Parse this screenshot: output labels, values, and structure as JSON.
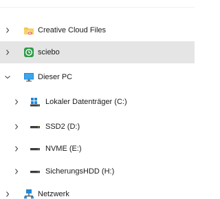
{
  "nav": {
    "items": [
      {
        "label": "Creative Cloud Files",
        "icon": "creative-cloud-folder-icon",
        "expanded": false,
        "selected": false
      },
      {
        "label": "sciebo",
        "icon": "sciebo-icon",
        "expanded": false,
        "selected": true
      },
      {
        "label": "Dieser PC",
        "icon": "computer-icon",
        "expanded": true,
        "selected": false
      },
      {
        "label": "Lokaler Datenträger (C:)",
        "icon": "windows-drive-icon",
        "expanded": false,
        "selected": false
      },
      {
        "label": "SSD2 (D:)",
        "icon": "drive-icon",
        "expanded": false,
        "selected": false
      },
      {
        "label": "NVME (E:)",
        "icon": "drive-icon",
        "expanded": false,
        "selected": false
      },
      {
        "label": "SicherungsHDD (H:)",
        "icon": "drive-icon",
        "expanded": false,
        "selected": false
      },
      {
        "label": "Netzwerk",
        "icon": "network-icon",
        "expanded": false,
        "selected": false
      }
    ]
  },
  "colors": {
    "selected_background": "#e5e5e5",
    "chevron": "#444444",
    "folder_yellow": "#f3c44a",
    "adobe_red": "#e3412a",
    "sciebo_green": "#2e9b48",
    "monitor_blue": "#1f8ad8"
  }
}
